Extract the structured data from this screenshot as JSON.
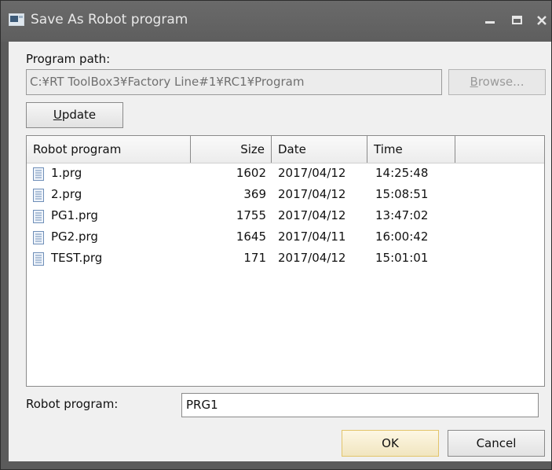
{
  "window": {
    "title": "Save As Robot program"
  },
  "path": {
    "label": "Program path:",
    "value": "C:¥RT ToolBox3¥Factory Line#1¥RC1¥Program"
  },
  "buttons": {
    "browse_mnemonic": "B",
    "browse_rest": "rowse...",
    "update_mnemonic": "U",
    "update_rest": "pdate",
    "ok": "OK",
    "cancel": "Cancel"
  },
  "table": {
    "columns": [
      "Robot program",
      "Size",
      "Date",
      "Time"
    ],
    "rows": [
      {
        "name": "1.prg",
        "size": "1602",
        "date": "2017/04/12",
        "time": "14:25:48"
      },
      {
        "name": "2.prg",
        "size": "369",
        "date": "2017/04/12",
        "time": "15:08:51"
      },
      {
        "name": "PG1.prg",
        "size": "1755",
        "date": "2017/04/12",
        "time": "13:47:02"
      },
      {
        "name": "PG2.prg",
        "size": "1645",
        "date": "2017/04/11",
        "time": "16:00:42"
      },
      {
        "name": "TEST.prg",
        "size": "171",
        "date": "2017/04/12",
        "time": "15:01:01"
      }
    ]
  },
  "program": {
    "label": "Robot program:",
    "value": "PRG1"
  },
  "icons": {
    "title": "window-app-icon",
    "file": "document-icon",
    "minimize": "minimize-icon",
    "maximize": "maximize-icon",
    "close": "close-icon"
  }
}
